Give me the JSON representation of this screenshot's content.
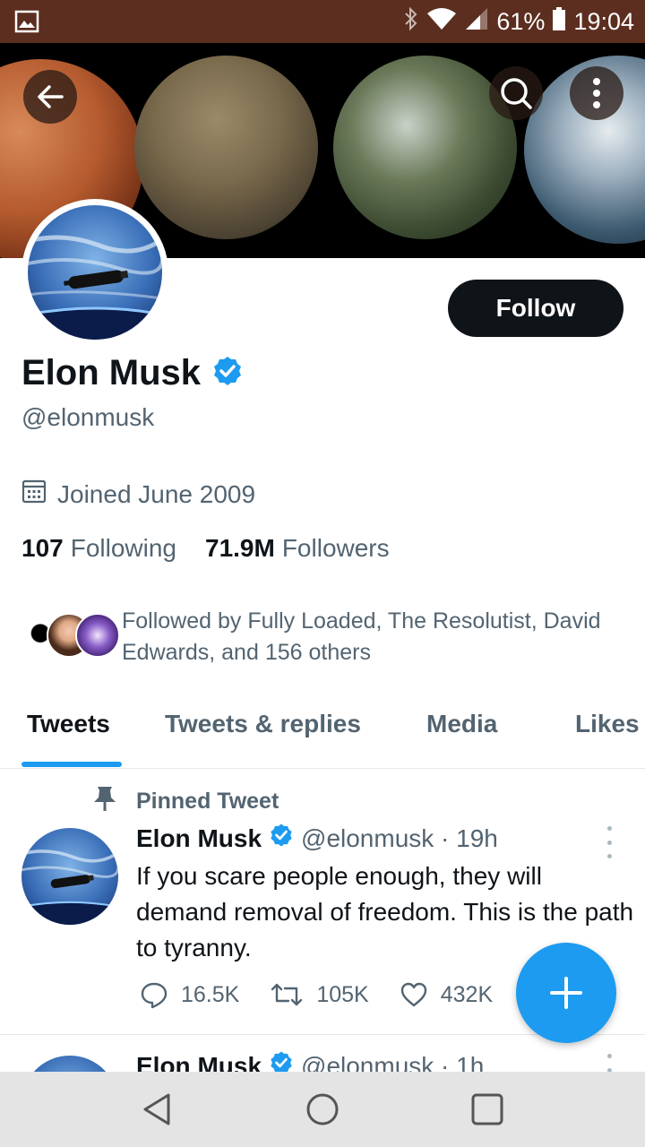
{
  "status_bar": {
    "battery": "61%",
    "time": "19:04",
    "icons": [
      "image-icon",
      "bluetooth-icon",
      "wifi-icon",
      "signal-icon",
      "battery-icon"
    ]
  },
  "header": {
    "icons": [
      "back-arrow-icon",
      "search-icon",
      "more-vertical-icon"
    ]
  },
  "profile": {
    "follow_label": "Follow",
    "name": "Elon Musk",
    "handle": "@elonmusk",
    "joined": "Joined June 2009",
    "following_count": "107",
    "following_label": "Following",
    "followers_count": "71.9M",
    "followers_label": "Followers",
    "followed_by": "Followed by Fully Loaded, The Resolutist, David Edwards, and 156 others"
  },
  "tabs": [
    {
      "label": "Tweets",
      "active": true
    },
    {
      "label": "Tweets & replies",
      "active": false
    },
    {
      "label": "Media",
      "active": false
    },
    {
      "label": "Likes",
      "active": false
    }
  ],
  "tweets": [
    {
      "pinned_label": "Pinned Tweet",
      "name": "Elon Musk",
      "meta": "@elonmusk · 19h",
      "text": "If you scare people enough, they will demand removal of freedom. This is the path to tyranny.",
      "replies": "16.5K",
      "retweets": "105K",
      "likes": "432K"
    },
    {
      "name": "Elon Musk",
      "meta": "@elonmusk · 1h"
    }
  ],
  "colors": {
    "status_bar": "#5c2e1f",
    "accent": "#1d9bf0",
    "primary_text": "#0f1419",
    "secondary_text": "#536471"
  },
  "nav_icons": [
    "back-triangle-icon",
    "home-circle-icon",
    "recents-square-icon"
  ]
}
